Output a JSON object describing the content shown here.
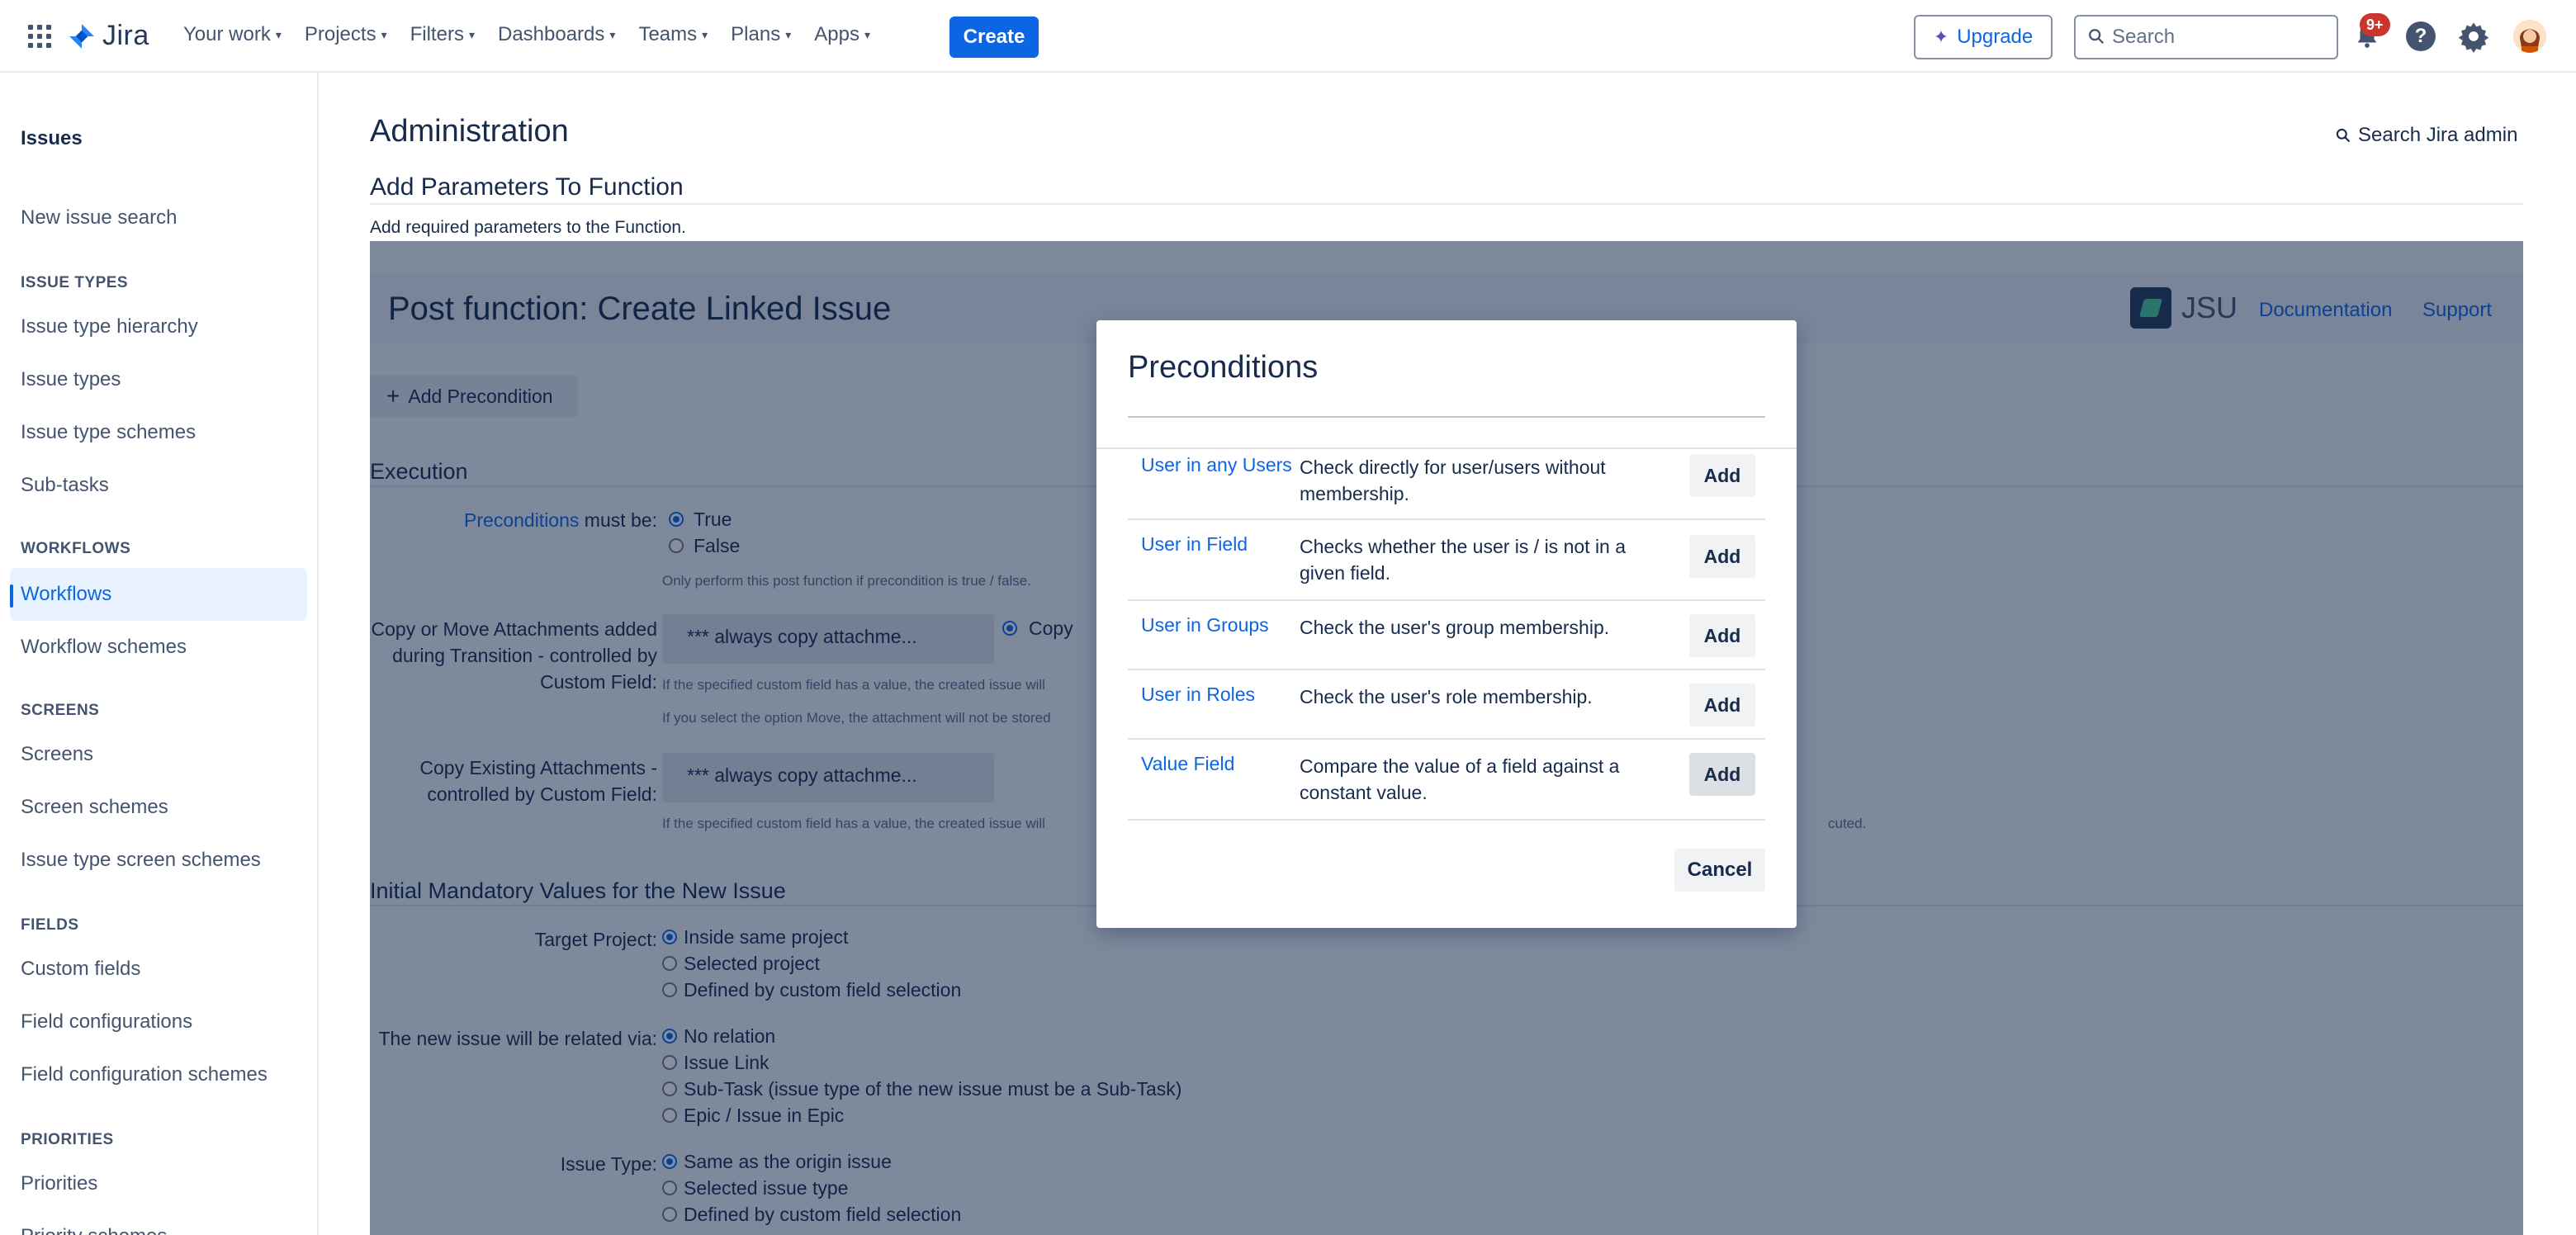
{
  "topnav": {
    "logo_text": "Jira",
    "items": [
      "Your work",
      "Projects",
      "Filters",
      "Dashboards",
      "Teams",
      "Plans",
      "Apps"
    ],
    "create_label": "Create",
    "upgrade_label": "Upgrade",
    "search_placeholder": "Search",
    "notifications_badge": "9+",
    "help_glyph": "?"
  },
  "sidebar": {
    "title": "Issues",
    "new_issue_search": "New issue search",
    "sections": [
      {
        "heading": "ISSUE TYPES",
        "items": [
          "Issue type hierarchy",
          "Issue types",
          "Issue type schemes",
          "Sub-tasks"
        ]
      },
      {
        "heading": "WORKFLOWS",
        "items": [
          "Workflows",
          "Workflow schemes"
        ]
      },
      {
        "heading": "SCREENS",
        "items": [
          "Screens",
          "Screen schemes",
          "Issue type screen schemes"
        ]
      },
      {
        "heading": "FIELDS",
        "items": [
          "Custom fields",
          "Field configurations",
          "Field configuration schemes"
        ]
      },
      {
        "heading": "PRIORITIES",
        "items": [
          "Priorities",
          "Priority schemes"
        ]
      }
    ],
    "active_item": "Workflows"
  },
  "main": {
    "title": "Administration",
    "search_admin": "Search Jira admin",
    "subtitle": "Add Parameters To Function",
    "description": "Add required parameters to the Function."
  },
  "postfunction": {
    "title": "Post function: Create Linked Issue",
    "brand": "JSU",
    "documentation": "Documentation",
    "support": "Support",
    "add_precondition": "Add Precondition",
    "execution_heading": "Execution",
    "preconditions_link": "Preconditions",
    "preconditions_suffix": " must be:",
    "true_label": "True",
    "false_label": "False",
    "preconditions_hint": "Only perform this post function if precondition is true / false.",
    "copy_move_label": "Copy or Move Attachments added during Transition - controlled by Custom Field:",
    "copy_move_select": "*** always copy attachme...",
    "copy_option": "Copy",
    "copy_move_hint1": "If the specified custom field has a value, the created issue will",
    "copy_move_hint2": "If you select the option Move, the attachment will not be stored",
    "copy_existing_label": "Copy Existing Attachments - controlled by Custom Field:",
    "copy_existing_select": "*** always copy attachme...",
    "copy_existing_hint": "If the specified custom field has a value, the created issue will",
    "copy_existing_hint_tail": "cuted.",
    "initial_heading": "Initial Mandatory Values for the New Issue",
    "target_project_label": "Target Project:",
    "target_project_options": [
      "Inside same project",
      "Selected project",
      "Defined by custom field selection"
    ],
    "relation_label": "The new issue will be related via:",
    "relation_options": [
      "No relation",
      "Issue Link",
      "Sub-Task (issue type of the new issue must be a Sub-Task)",
      "Epic / Issue in Epic"
    ],
    "issue_type_label": "Issue Type:",
    "issue_type_options": [
      "Same as the origin issue",
      "Selected issue type",
      "Defined by custom field selection"
    ]
  },
  "modal": {
    "title": "Preconditions",
    "rows": [
      {
        "name": "User in any Users",
        "desc": "Check directly for user/users without membership.",
        "add": "Add"
      },
      {
        "name": "User in Field",
        "desc": "Checks whether the user is / is not in a given field.",
        "add": "Add"
      },
      {
        "name": "User in Groups",
        "desc": "Check the user's group membership.",
        "add": "Add"
      },
      {
        "name": "User in Roles",
        "desc": "Check the user's role membership.",
        "add": "Add"
      },
      {
        "name": "Value Field",
        "desc": "Compare the value of a field against a constant value.",
        "add": "Add"
      }
    ],
    "cancel": "Cancel"
  },
  "colors": {
    "accent": "#0c66e4",
    "badge": "#c9372c",
    "overlay": "#091e42"
  },
  "icons": [
    "app-grid-icon",
    "jira-logo-icon",
    "sparkle-icon",
    "search-icon",
    "bell-icon",
    "help-icon",
    "gear-icon",
    "avatar",
    "jsu-logo-icon",
    "plus-icon"
  ]
}
